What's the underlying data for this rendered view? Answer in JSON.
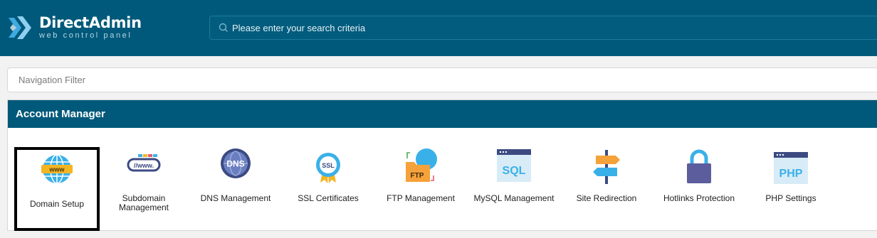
{
  "brand": {
    "name": "DirectAdmin",
    "tagline": "web control panel"
  },
  "search": {
    "placeholder": "Please enter your search criteria"
  },
  "nav_filter": {
    "placeholder": "Navigation Filter"
  },
  "account_manager": {
    "title": "Account Manager",
    "items": [
      {
        "label": "Domain Setup",
        "icon": "www-globe-icon",
        "selected": true
      },
      {
        "label": "Subdomain Management",
        "icon": "subdomain-icon"
      },
      {
        "label": "DNS Management",
        "icon": "dns-globe-icon"
      },
      {
        "label": "SSL Certificates",
        "icon": "ssl-badge-icon"
      },
      {
        "label": "FTP Management",
        "icon": "ftp-folder-icon"
      },
      {
        "label": "MySQL Management",
        "icon": "sql-window-icon"
      },
      {
        "label": "Site Redirection",
        "icon": "signpost-icon"
      },
      {
        "label": "Hotlinks Protection",
        "icon": "padlock-icon"
      },
      {
        "label": "PHP Settings",
        "icon": "php-window-icon"
      }
    ]
  },
  "colors": {
    "header": "#00597a",
    "selection_border": "#000000"
  }
}
